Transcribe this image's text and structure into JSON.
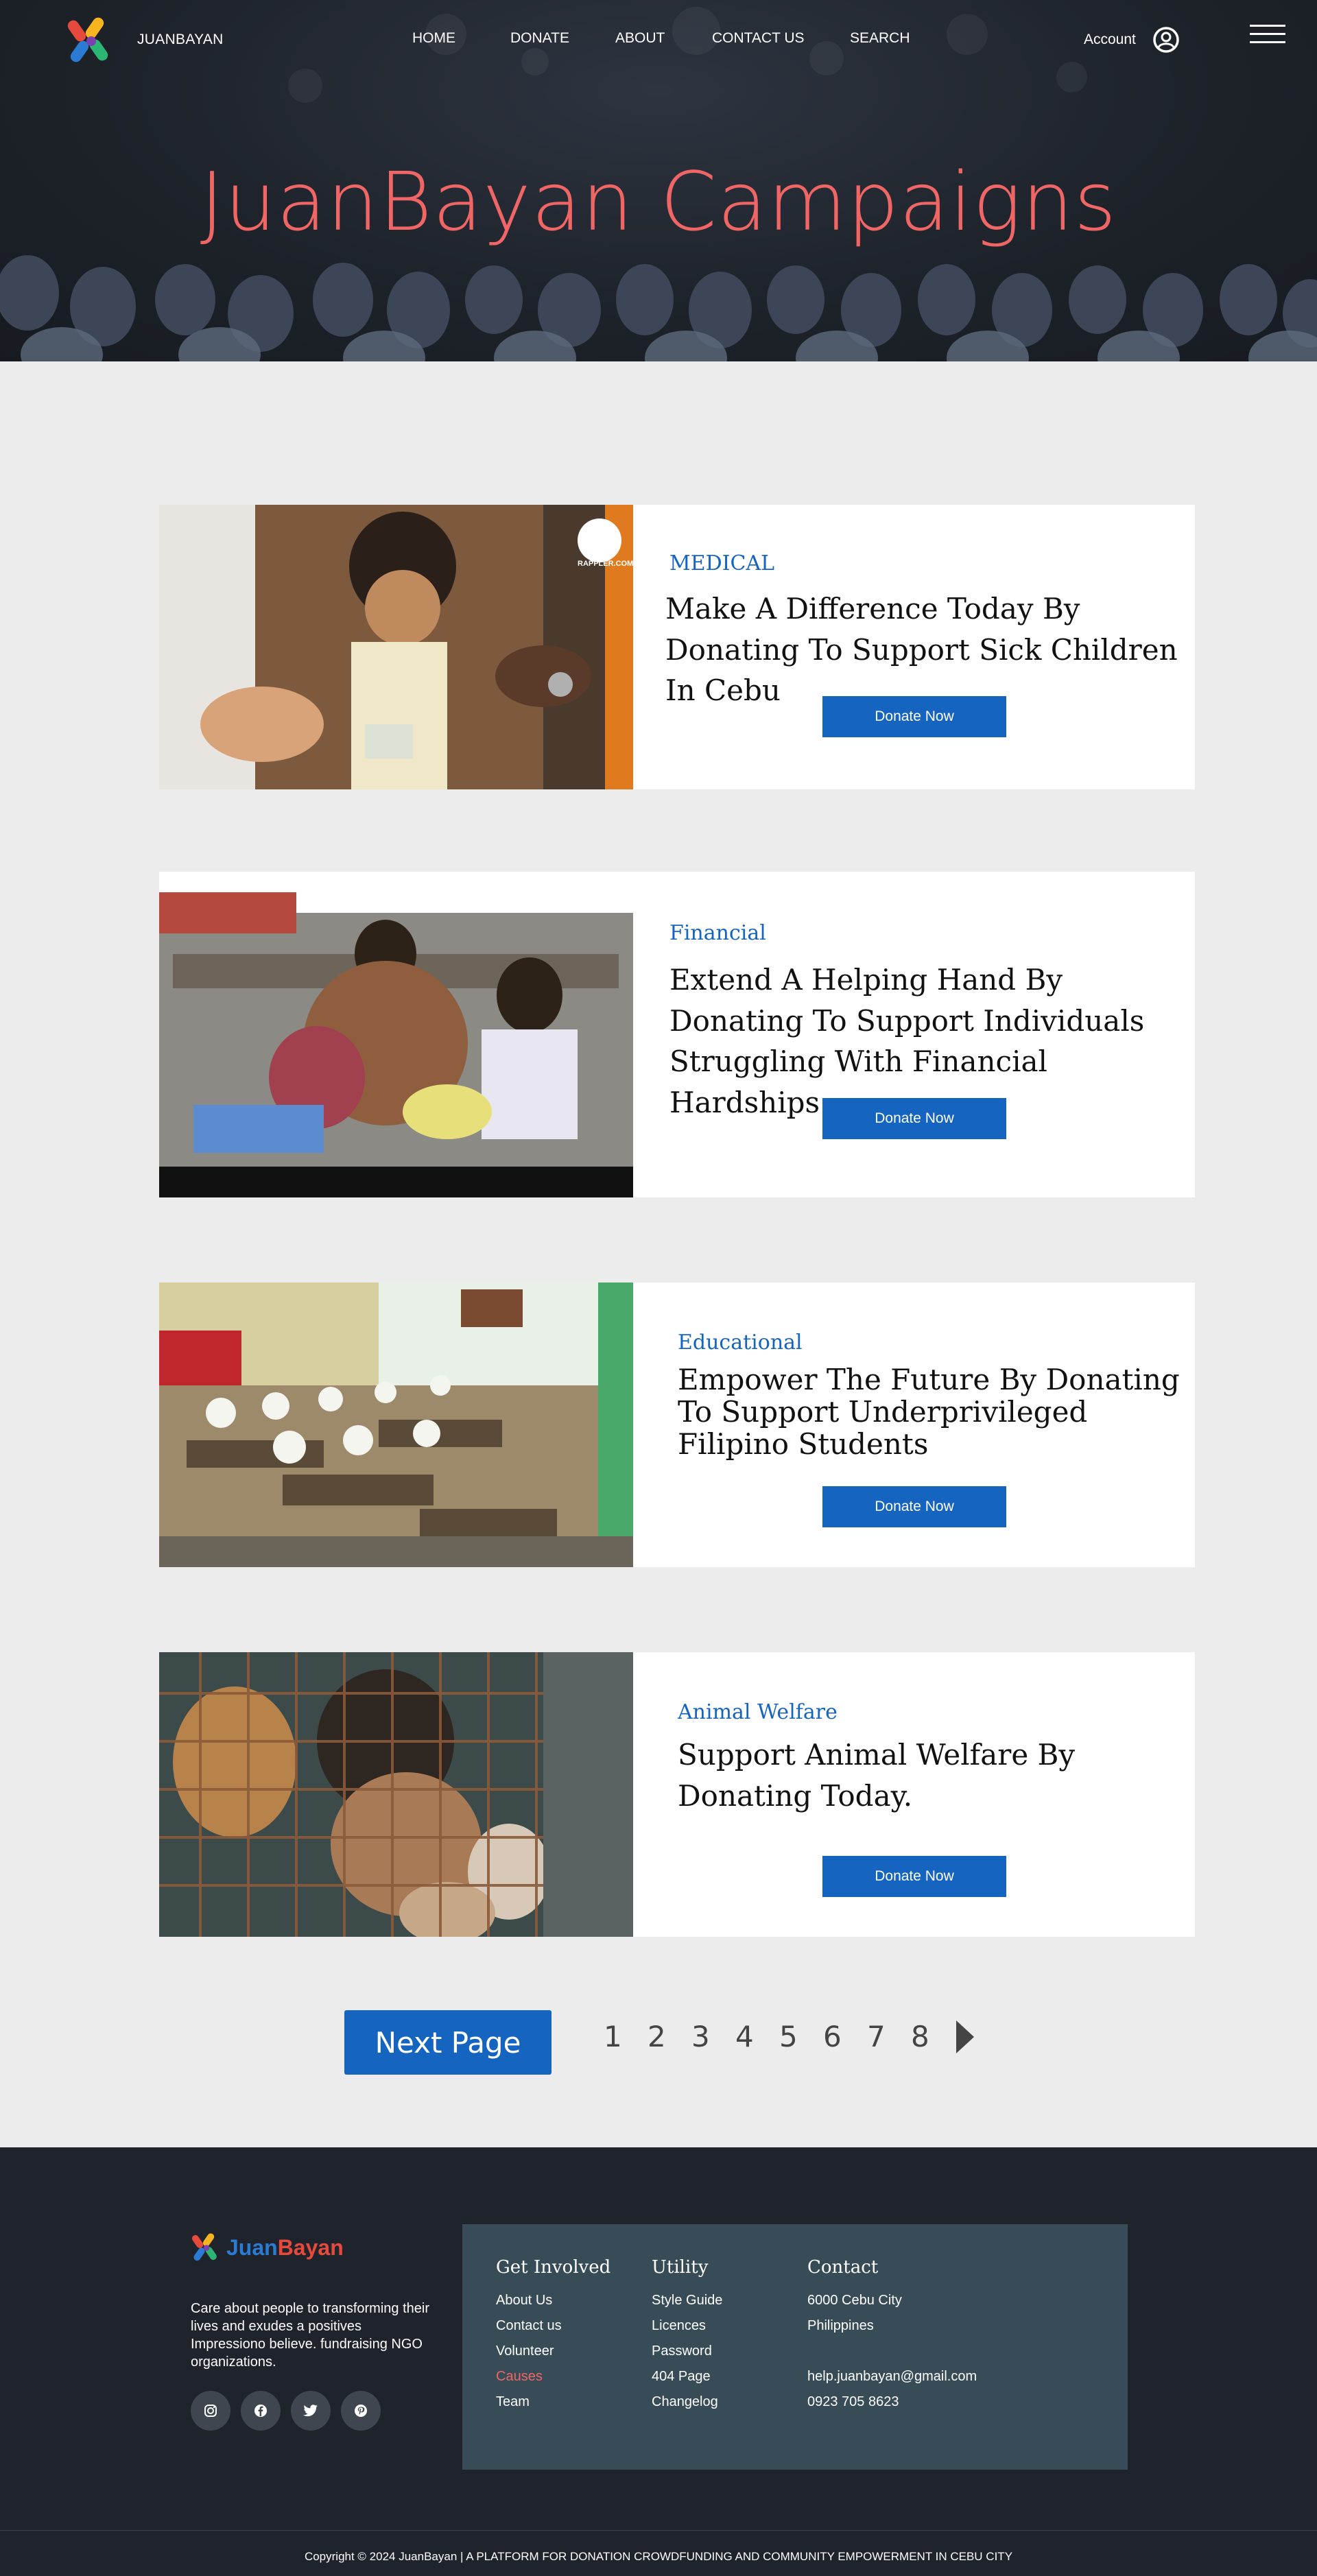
{
  "header": {
    "brand": "JUANBAYAN",
    "nav": [
      "HOME",
      "DONATE",
      "ABOUT",
      "CONTACT US",
      "SEARCH"
    ],
    "account_label": "Account",
    "hero_title": "JuanBayan Campaigns"
  },
  "campaigns": [
    {
      "category": "MEDICAL",
      "title": "Make A Difference Today By Donating To Support Sick Children In Cebu",
      "button": "Donate Now",
      "photo_watermark": "RAPPLER.COM"
    },
    {
      "category": "Financial",
      "title": "Extend A Helping Hand By Donating To Support Individuals Struggling With Financial Hardships.",
      "button": "Donate Now"
    },
    {
      "category": "Educational",
      "title": "Empower The Future By Donating To Support Underprivileged Filipino Students",
      "button": "Donate Now"
    },
    {
      "category": "Animal Welfare",
      "title": "Support Animal Welfare By Donating Today.",
      "button": "Donate Now"
    }
  ],
  "pagination": {
    "next_label": "Next Page",
    "pages": [
      "1",
      "2",
      "3",
      "4",
      "5",
      "6",
      "7",
      "8"
    ]
  },
  "footer": {
    "logo_text": "JuanBayan",
    "description": "Care about people to transforming their lives and exudes a positives Impressiono believe. fundraising NGO organizations.",
    "socials": [
      "instagram-icon",
      "facebook-icon",
      "twitter-icon",
      "pinterest-icon"
    ],
    "columns": [
      {
        "heading": "Get Involved",
        "links": [
          "About Us",
          "Contact us",
          "Volunteer",
          "Causes",
          "Team"
        ]
      },
      {
        "heading": "Utility",
        "links": [
          "Style Guide",
          "Licences",
          "Password",
          "404 Page",
          "Changelog"
        ]
      },
      {
        "heading": "Contact",
        "links": [
          "6000 Cebu City",
          "Philippines",
          "",
          "help.juanbayan@gmail.com",
          "0923 705 8623"
        ]
      }
    ],
    "copyright": "Copyright © 2024 JuanBayan | A PLATFORM FOR DONATION CROWDFUNDING AND COMMUNITY EMPOWERMENT IN CEBU CITY"
  },
  "colors": {
    "accent_blue": "#1565c0",
    "hero_title_coral": "#f06666",
    "header_dark": "#1d2229",
    "footer_dark": "#1f232c",
    "footer_panel": "#374c56",
    "active_link": "#f06666"
  }
}
